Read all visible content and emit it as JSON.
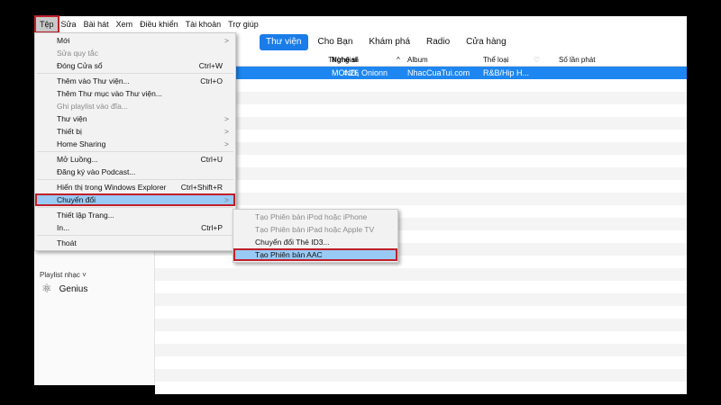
{
  "menubar": [
    "Tệp",
    "Sửa",
    "Bài hát",
    "Xem",
    "Điều khiển",
    "Tài khoản",
    "Trợ giúp"
  ],
  "tabs": [
    "Thư viện",
    "Cho Bạn",
    "Khám phá",
    "Radio",
    "Cửa hàng"
  ],
  "columns": {
    "time": "Thời gian",
    "artist": "Nghệ sĩ",
    "sort": "^",
    "album": "Album",
    "genre": "Thể loại",
    "heart": "♡",
    "plays": "Số lần phát"
  },
  "track": {
    "time": "4:26",
    "artist": "MONO, Onionn",
    "album": "NhacCuaTui.com",
    "genre": "R&B/Hip H..."
  },
  "sidebar": {
    "section": "Playlist nhạc ˅",
    "genius": "Genius"
  },
  "file_menu": [
    {
      "label": "Mới",
      "arrow": ">"
    },
    {
      "label": "Sửa quy tắc",
      "disabled": true
    },
    {
      "label": "Đóng Cửa sổ",
      "shortcut": "Ctrl+W"
    },
    {
      "sep": true
    },
    {
      "label": "Thêm vào Thư viện...",
      "shortcut": "Ctrl+O"
    },
    {
      "label": "Thêm Thư mục vào Thư viện..."
    },
    {
      "label": "Ghi playlist vào đĩa...",
      "disabled": true
    },
    {
      "label": "Thư viện",
      "arrow": ">"
    },
    {
      "label": "Thiết bị",
      "arrow": ">"
    },
    {
      "label": "Home Sharing",
      "arrow": ">"
    },
    {
      "sep": true
    },
    {
      "label": "Mở Luồng...",
      "shortcut": "Ctrl+U"
    },
    {
      "label": "Đăng ký vào Podcast..."
    },
    {
      "sep": true
    },
    {
      "label": "Hiển thị trong Windows Explorer",
      "shortcut": "Ctrl+Shift+R"
    },
    {
      "label": "Chuyển đổi",
      "arrow": ">",
      "highlight": true
    },
    {
      "sep": true
    },
    {
      "label": "Thiết lập Trang..."
    },
    {
      "label": "In...",
      "shortcut": "Ctrl+P"
    },
    {
      "sep": true
    },
    {
      "label": "Thoát"
    }
  ],
  "convert_menu": [
    {
      "label": "Tạo Phiên bản iPod hoặc iPhone",
      "disabled": true
    },
    {
      "label": "Tạo Phiên bản iPad hoặc Apple TV",
      "disabled": true
    },
    {
      "label": "Chuyển đổi Thẻ ID3..."
    },
    {
      "label": "Tạo Phiên bản AAC",
      "highlight": true
    }
  ]
}
